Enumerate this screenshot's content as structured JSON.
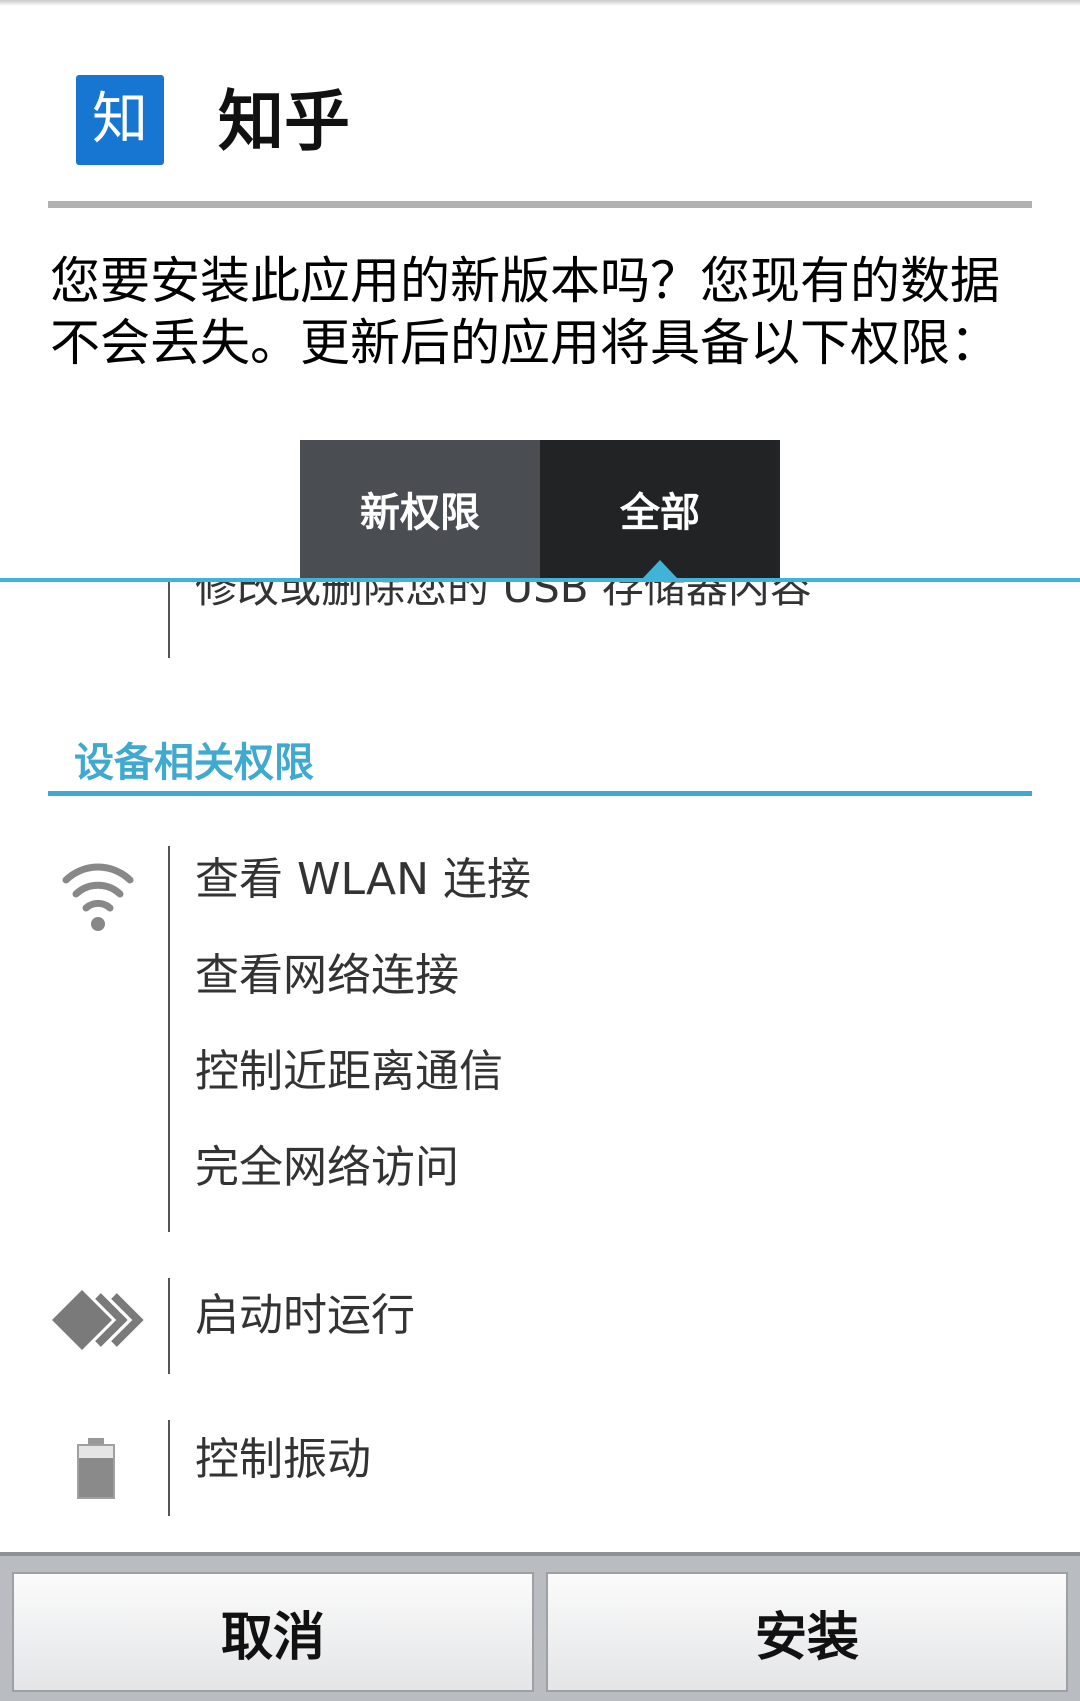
{
  "app": {
    "icon_char": "知",
    "title": "知乎"
  },
  "message": "您要安装此应用的新版本吗？您现有的数据不会丢失。更新后的应用将具备以下权限：",
  "tabs": [
    {
      "label": "新权限",
      "selected": false
    },
    {
      "label": "全部",
      "selected": true
    }
  ],
  "permissions": {
    "partial_item": "修改或删除您的 USB 存储器内容",
    "section_header": "设备相关权限",
    "groups": [
      {
        "icon": "wifi-icon",
        "items": [
          "查看 WLAN 连接",
          "查看网络连接",
          "控制近距离通信",
          "完全网络访问"
        ]
      },
      {
        "icon": "startup-arrows-icon",
        "items": [
          "启动时运行"
        ]
      },
      {
        "icon": "battery-icon",
        "items": [
          "控制振动"
        ]
      }
    ]
  },
  "buttons": {
    "cancel": "取消",
    "install": "安装"
  },
  "colors": {
    "accent": "#3fb3d8",
    "app_icon": "#1676d2",
    "tab_inactive": "#4a4d52",
    "tab_active": "#222325"
  }
}
